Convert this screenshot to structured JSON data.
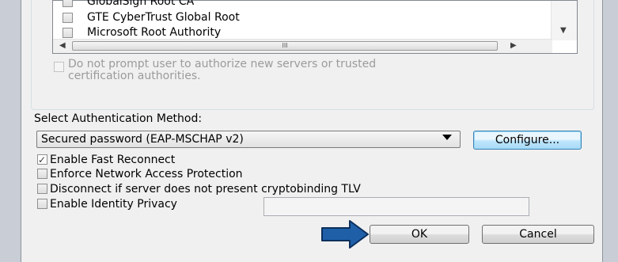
{
  "root_ca_list": {
    "items": [
      {
        "label": "GlobalSign Root CA",
        "checked": false
      },
      {
        "label": "GTE CyberTrust Global Root",
        "checked": false
      },
      {
        "label": "Microsoft Root Authority",
        "checked": false
      }
    ],
    "scroll_thumb_grip": "III"
  },
  "do_not_prompt": {
    "line1": "Do not prompt user to authorize new servers or trusted",
    "line2": "certification authorities.",
    "checked": false,
    "enabled": false
  },
  "auth_method": {
    "label": "Select Authentication Method:",
    "selected": "Secured password (EAP-MSCHAP v2)",
    "configure_label": "Configure..."
  },
  "options": {
    "enable_fast_reconnect": {
      "label": "Enable Fast Reconnect",
      "checked": true
    },
    "enforce_nap": {
      "label": "Enforce Network Access Protection",
      "checked": false
    },
    "disconnect_cryptobinding": {
      "label": "Disconnect if server does not present cryptobinding TLV",
      "checked": false
    },
    "identity_privacy": {
      "label": "Enable Identity Privacy",
      "checked": false,
      "value": ""
    }
  },
  "footer": {
    "ok_label": "OK",
    "cancel_label": "Cancel"
  },
  "annotation": {
    "arrow_color": "#1f5fa8"
  }
}
